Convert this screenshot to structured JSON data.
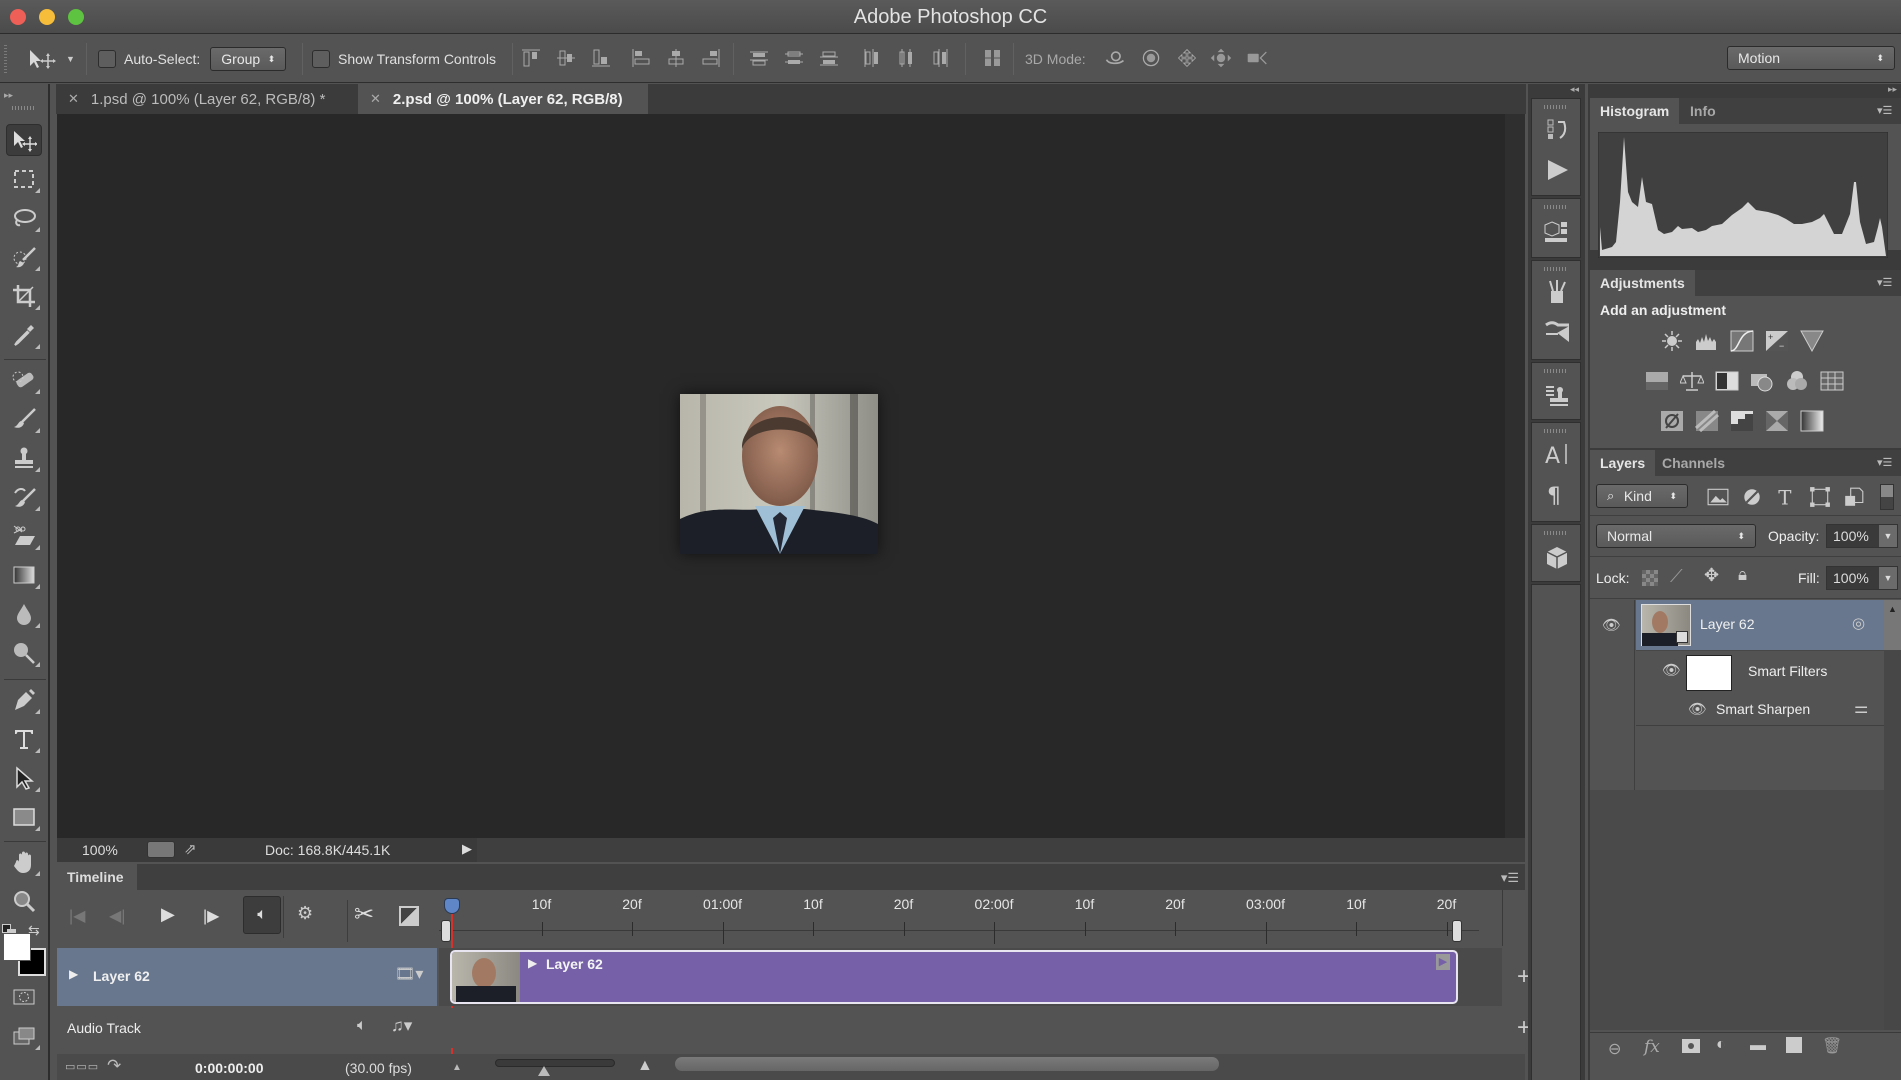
{
  "app": {
    "title": "Adobe Photoshop CC"
  },
  "options_bar": {
    "auto_select_label": "Auto-Select:",
    "auto_select_checked": false,
    "auto_select_target": "Group",
    "show_transform_label": "Show Transform Controls",
    "show_transform_checked": false,
    "mode3d_label": "3D Mode:",
    "workspace": "Motion"
  },
  "tabs": [
    {
      "label": "1.psd @ 100% (Layer 62, RGB/8) *",
      "active": false
    },
    {
      "label": "2.psd @ 100% (Layer 62, RGB/8)",
      "active": true
    }
  ],
  "tools": [
    "move",
    "marquee",
    "lasso",
    "quick-selection",
    "crop",
    "eyedropper",
    "healing-brush",
    "brush",
    "clone-stamp",
    "history-brush",
    "eraser",
    "gradient",
    "blur",
    "dodge",
    "pen",
    "type",
    "path-selection",
    "rectangle",
    "hand",
    "zoom"
  ],
  "colors": {
    "foreground": "#ffffff",
    "background": "#000000",
    "clip": "#7661a8",
    "layer_row": "#68778d"
  },
  "status": {
    "zoom": "100%",
    "doc": "Doc: 168.8K/445.1K"
  },
  "timeline": {
    "title": "Timeline",
    "ruler": [
      "10f",
      "20f",
      "01:00f",
      "10f",
      "20f",
      "02:00f",
      "10f",
      "20f",
      "03:00f",
      "10f",
      "20f"
    ],
    "track_name": "Layer 62",
    "clip_name": "Layer 62",
    "audio_track": "Audio Track",
    "timecode": "0:00:00:00",
    "fps": "(30.00 fps)",
    "zoom_slider": 0.4
  },
  "panels": {
    "histogram_tabs": [
      "Histogram",
      "Info"
    ],
    "adjustments": {
      "tab": "Adjustments",
      "heading": "Add an adjustment"
    },
    "layers_tabs": [
      "Layers",
      "Channels"
    ],
    "filter_kind": "Kind",
    "blend_mode": "Normal",
    "opacity_label": "Opacity:",
    "opacity": "100%",
    "lock_label": "Lock:",
    "fill_label": "Fill:",
    "fill": "100%",
    "layers": [
      {
        "name": "Layer 62",
        "visible": true,
        "selected": true
      },
      {
        "name": "Smart Filters",
        "visible": true
      },
      {
        "name": "Smart Sharpen",
        "visible": true
      }
    ]
  }
}
